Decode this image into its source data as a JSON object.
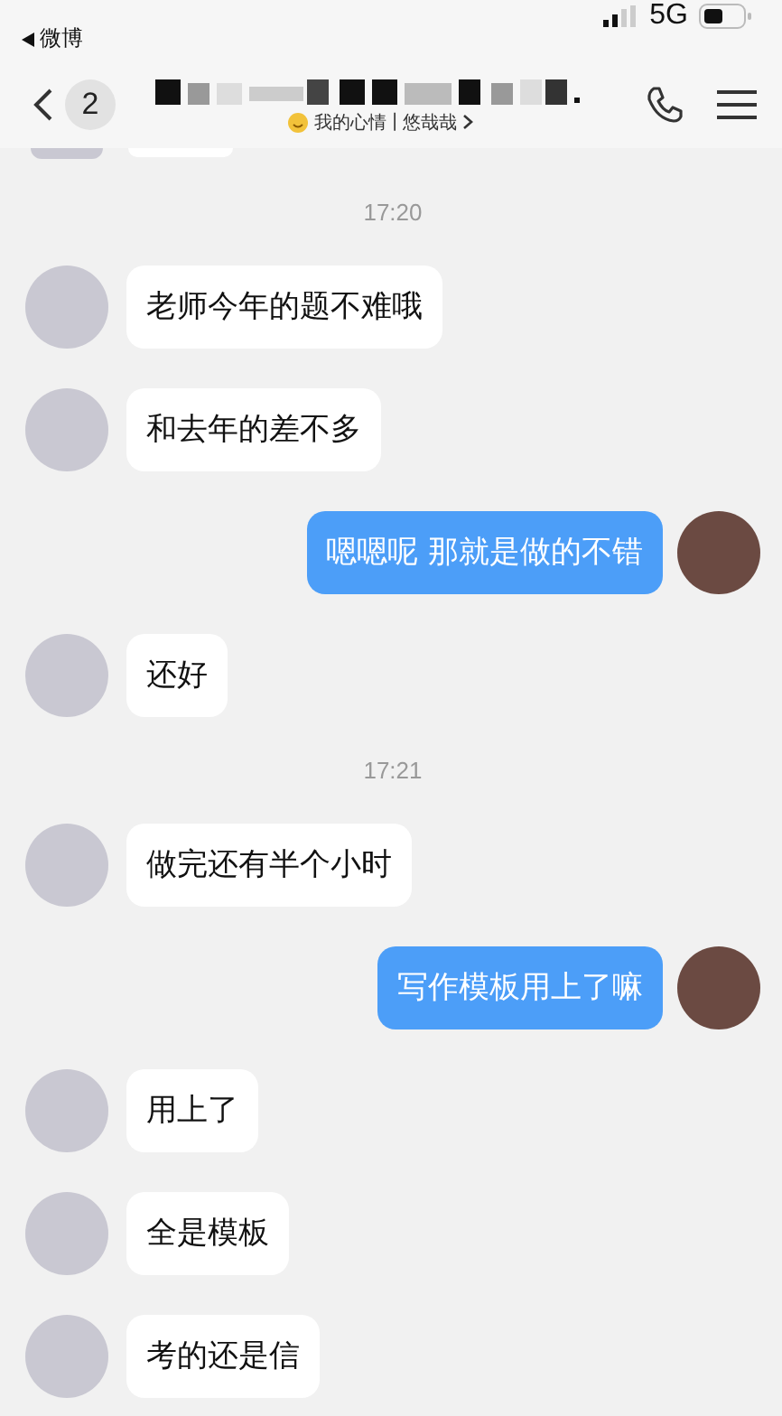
{
  "status_bar": {
    "back_app": "微博",
    "network": "5G"
  },
  "nav": {
    "unread": "2",
    "status_label": "我的心情",
    "separator": "|",
    "status": "悠哉哉"
  },
  "messages": [
    {
      "kind": "fragment"
    },
    {
      "kind": "time",
      "text": "17:20"
    },
    {
      "kind": "incoming",
      "text": "老师今年的题不难哦"
    },
    {
      "kind": "incoming",
      "text": "和去年的差不多"
    },
    {
      "kind": "outgoing",
      "text": "嗯嗯呢 那就是做的不错"
    },
    {
      "kind": "incoming",
      "text": "还好"
    },
    {
      "kind": "time",
      "text": "17:21"
    },
    {
      "kind": "incoming",
      "text": "做完还有半个小时"
    },
    {
      "kind": "outgoing",
      "text": "写作模板用上了嘛"
    },
    {
      "kind": "incoming",
      "text": "用上了"
    },
    {
      "kind": "incoming",
      "text": "全是模板"
    },
    {
      "kind": "incoming",
      "text": "考的还是信"
    }
  ]
}
